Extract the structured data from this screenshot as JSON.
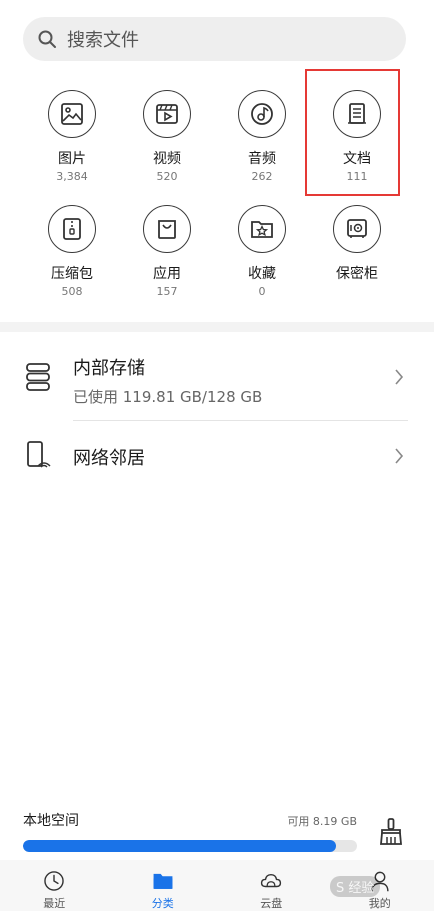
{
  "search": {
    "placeholder": "搜索文件"
  },
  "categories": [
    {
      "label": "图片",
      "count": "3,384",
      "icon": "image-icon"
    },
    {
      "label": "视频",
      "count": "520",
      "icon": "video-icon"
    },
    {
      "label": "音频",
      "count": "262",
      "icon": "music-icon"
    },
    {
      "label": "文档",
      "count": "111",
      "icon": "document-icon"
    },
    {
      "label": "压缩包",
      "count": "508",
      "icon": "zip-icon"
    },
    {
      "label": "应用",
      "count": "157",
      "icon": "app-bag-icon"
    },
    {
      "label": "收藏",
      "count": "0",
      "icon": "favorite-folder-icon"
    },
    {
      "label": "保密柜",
      "count": "",
      "icon": "safe-icon"
    }
  ],
  "locations": {
    "internal": {
      "title": "内部存储",
      "subtitle": "已使用 119.81 GB/128 GB"
    },
    "network": {
      "title": "网络邻居"
    }
  },
  "storage": {
    "title": "本地空间",
    "available": "可用 8.19 GB",
    "used_fraction": 0.936
  },
  "tabs": [
    {
      "label": "最近",
      "icon": "clock-icon"
    },
    {
      "label": "分类",
      "icon": "folder-icon",
      "active": true
    },
    {
      "label": "云盘",
      "icon": "cloud-icon"
    },
    {
      "label": "我的",
      "icon": "person-icon"
    }
  ],
  "watermark": "S 经验",
  "colors": {
    "accent": "#1a73e8",
    "highlight": "#e53935"
  }
}
